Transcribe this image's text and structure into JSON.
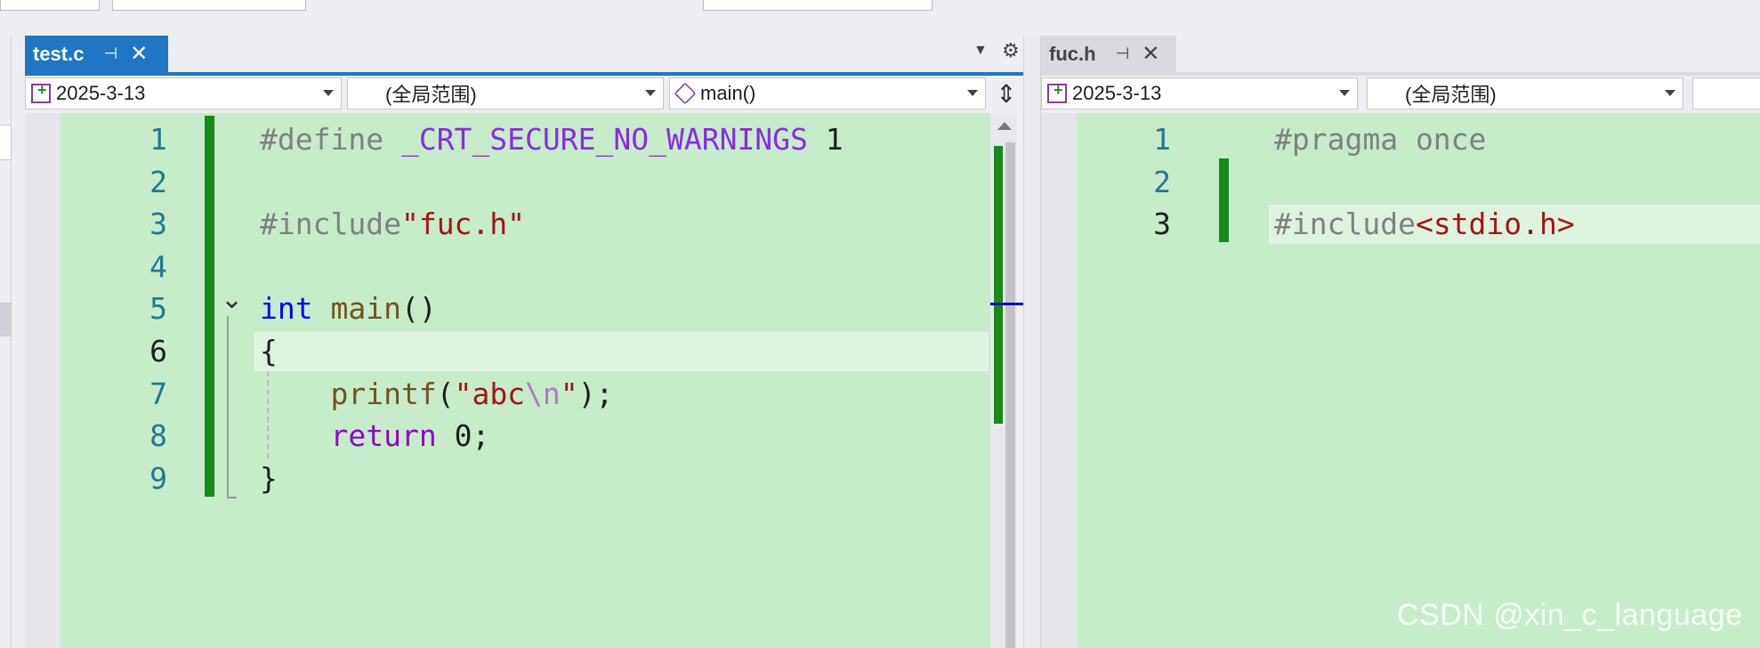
{
  "left_pane": {
    "tab_title": "test.c",
    "pin_glyph": "⊣",
    "close_glyph": "✕",
    "nav": {
      "project": "2025-3-13",
      "scope": "(全局范围)",
      "member": "main()"
    },
    "current_line": 6,
    "lines": [
      {
        "n": "1",
        "tokens": [
          {
            "t": "#define ",
            "c": "pp"
          },
          {
            "t": "_CRT_SECURE_NO_WARNINGS",
            "c": "macro"
          },
          {
            "t": " 1",
            "c": "plain"
          }
        ]
      },
      {
        "n": "2",
        "tokens": []
      },
      {
        "n": "3",
        "tokens": [
          {
            "t": "#include",
            "c": "pp"
          },
          {
            "t": "\"fuc.h\"",
            "c": "str"
          }
        ]
      },
      {
        "n": "4",
        "tokens": []
      },
      {
        "n": "5",
        "tokens": [
          {
            "t": "int",
            "c": "kw"
          },
          {
            "t": " ",
            "c": "plain"
          },
          {
            "t": "main",
            "c": "fn"
          },
          {
            "t": "()",
            "c": "plain"
          }
        ]
      },
      {
        "n": "6",
        "tokens": [
          {
            "t": "{",
            "c": "plain"
          }
        ]
      },
      {
        "n": "7",
        "tokens": [
          {
            "t": "    ",
            "c": "plain"
          },
          {
            "t": "printf",
            "c": "fn"
          },
          {
            "t": "(",
            "c": "plain"
          },
          {
            "t": "\"abc",
            "c": "str"
          },
          {
            "t": "\\n",
            "c": "esc"
          },
          {
            "t": "\"",
            "c": "str"
          },
          {
            "t": ");",
            "c": "plain"
          }
        ]
      },
      {
        "n": "8",
        "tokens": [
          {
            "t": "    ",
            "c": "plain"
          },
          {
            "t": "return",
            "c": "ctl"
          },
          {
            "t": " 0;",
            "c": "plain"
          }
        ]
      },
      {
        "n": "9",
        "tokens": [
          {
            "t": "}",
            "c": "plain"
          }
        ]
      }
    ]
  },
  "right_pane": {
    "tab_title": "fuc.h",
    "pin_glyph": "⊣",
    "close_glyph": "✕",
    "nav": {
      "project": "2025-3-13",
      "scope": "(全局范围)"
    },
    "current_line": 3,
    "lines": [
      {
        "n": "1",
        "tokens": [
          {
            "t": "#pragma once",
            "c": "pp"
          }
        ]
      },
      {
        "n": "2",
        "tokens": []
      },
      {
        "n": "3",
        "tokens": [
          {
            "t": "#include",
            "c": "pp"
          },
          {
            "t": "<stdio.h>",
            "c": "str"
          }
        ]
      }
    ]
  },
  "collapse_glyph": "⌄",
  "split_glyph": "⇕",
  "gear_glyph": "⚙",
  "watermark": "CSDN @xin_c_language",
  "colors": {
    "accent": "#1f76c5",
    "editor_bg": "#c6ecca",
    "change_bar": "#188a1a"
  }
}
